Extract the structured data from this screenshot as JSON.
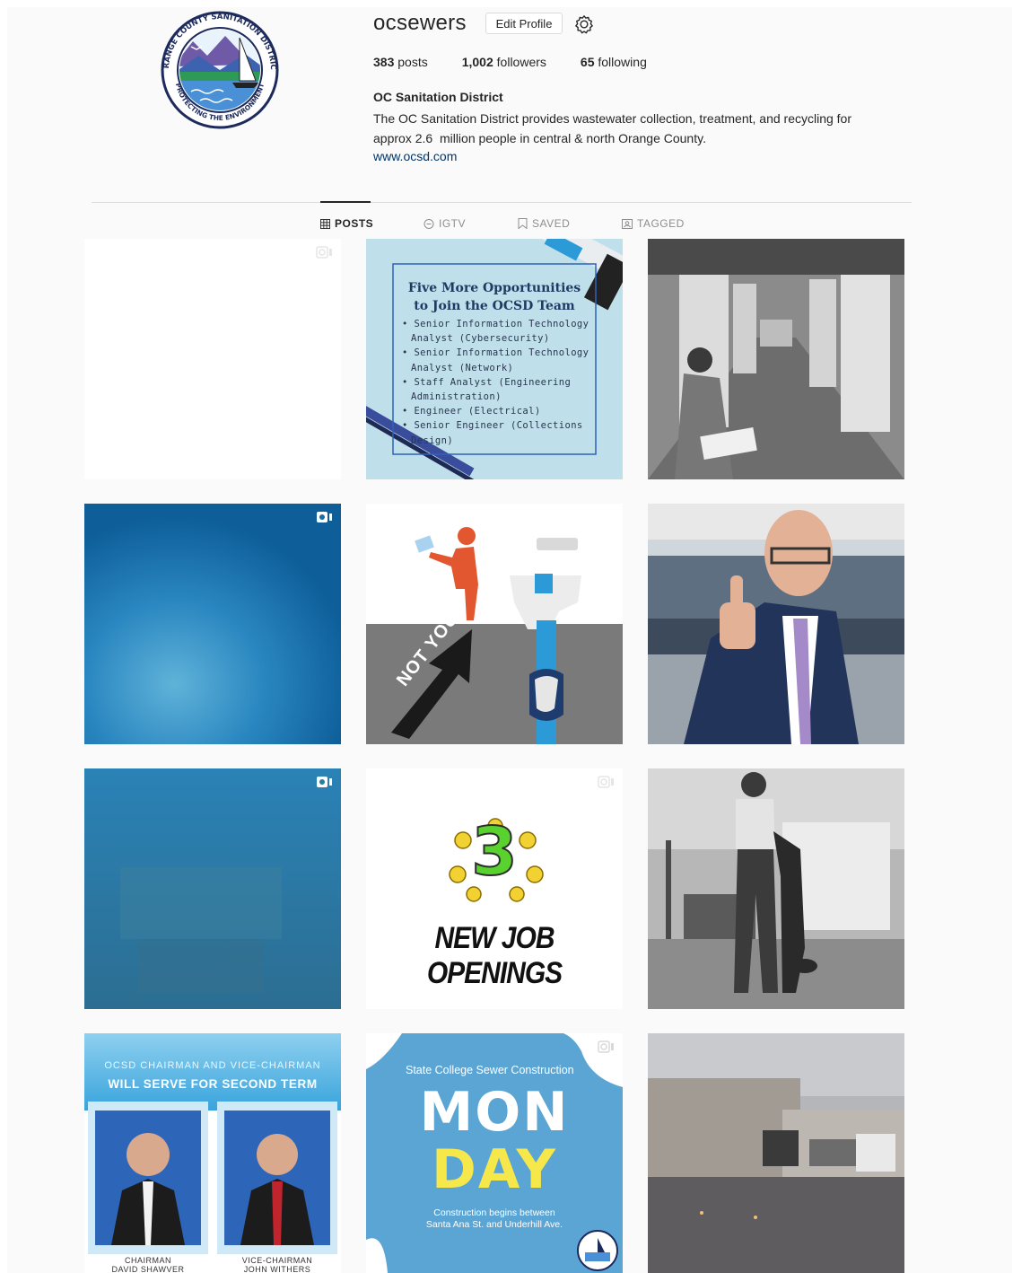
{
  "profile": {
    "username": "ocsewers",
    "edit_label": "Edit Profile",
    "posts_count": "383",
    "posts_label": "posts",
    "followers_count": "1,002",
    "followers_label": "followers",
    "following_count": "65",
    "following_label": "following",
    "full_name": "OC Sanitation District",
    "bio_line1": "The OC Sanitation District provides wastewater collection, treatment, and recycling for",
    "bio_line2": "approx 2.6  million people in central & north Orange County.",
    "website": "www.ocsd.com",
    "logo_ring_top": "ORANGE COUNTY SANITATION DISTRICT",
    "logo_ring_bottom": "PROTECTING THE ENVIRONMENT"
  },
  "tabs": [
    {
      "label": "POSTS",
      "icon": "grid-icon",
      "active": true
    },
    {
      "label": "IGTV",
      "icon": "igtv-icon",
      "active": false
    },
    {
      "label": "SAVED",
      "icon": "bookmark-icon",
      "active": false
    },
    {
      "label": "TAGGED",
      "icon": "tag-icon",
      "active": false
    }
  ],
  "posts": {
    "jobs5": {
      "title1": "Five More Opportunities",
      "title2": "to Join the OCSD Team",
      "items": [
        "• Senior Information Technology",
        "Analyst (Cybersecurity)",
        "• Senior Information Technology",
        "Analyst (Network)",
        "• Staff Analyst (Engineering",
        "Administration)",
        "• Engineer (Electrical)",
        "• Senior Engineer (Collections",
        "Design)"
      ]
    },
    "notyou": {
      "arrow_text": "NOT YOU"
    },
    "jobs3": {
      "number": "3",
      "text": "NEW JOB OPENINGS"
    },
    "chairman": {
      "line1": "OCSD CHAIRMAN AND VICE-CHAIRMAN",
      "line2": "WILL SERVE FOR SECOND TERM",
      "left_title": "CHAIRMAN",
      "left_name": "DAVID SHAWVER",
      "right_title": "VICE-CHAIRMAN",
      "right_name": "JOHN WITHERS"
    },
    "monday": {
      "header": "State College Sewer Construction",
      "mon": "MON",
      "day": "DAY",
      "sub1": "Construction begins between",
      "sub2": "Santa Ana St. and Underhill Ave."
    }
  },
  "colors": {
    "link": "#003569",
    "divider": "#dbdbdb",
    "muted": "#8e8e8e",
    "jobs_bg": "#bfe0ea",
    "monday_bg": "#5aa5d4",
    "ocean": "#1b6fa6"
  }
}
